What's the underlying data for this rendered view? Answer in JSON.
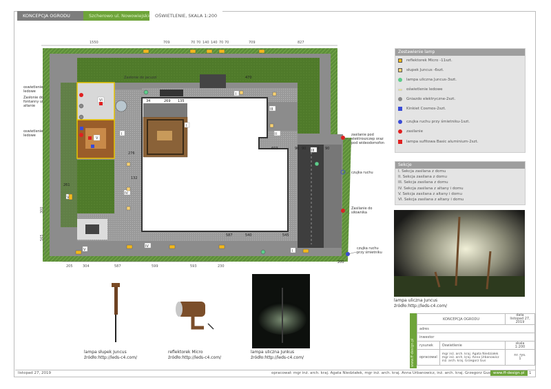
{
  "header": {
    "company": "KONCEPCJA OGRODU",
    "location": "Szcherowo ul. Nowowiejskiego",
    "drawing": "OŚWIETLENIE, SKALA 1:200"
  },
  "plan": {
    "dims_top": [
      "1550",
      "709",
      "70",
      "70",
      "140",
      "140",
      "70",
      "70",
      "709",
      "827"
    ],
    "dims_bottom": [
      "205",
      "304",
      "587",
      "599",
      "593",
      "230"
    ],
    "dims_left": [
      "300",
      "565"
    ],
    "inner_dims": {
      "d470": "470",
      "d34": "34",
      "d269": "269",
      "d135": "135",
      "d132": "132",
      "d276": "276",
      "d261": "261",
      "d603": "603",
      "d90a": "90",
      "d90b": "90",
      "d230": "230",
      "d90c": "90",
      "d200": "200",
      "d587": "587",
      "d540": "540",
      "d545": "545"
    },
    "labels": {
      "zaslonie_pd": "Zasłonie do jacuzzi",
      "ogrodowe": "oswietlenie ledowe",
      "zasl_fontanny": "Zasłonie do fontanny ui altanie",
      "oswietlenie_ledowe2": "oswietlenie ledowe",
      "zasilanie_pod": "zasilanie pod elektroszczep oraz pod wideodomofon",
      "czujka": "czujka ruchu",
      "zasilanie_slonik": "Zasilanie do siłownika",
      "czujka2": "czujka ruchu przy śmietniku"
    },
    "section_tags": [
      "VI",
      "V",
      "I",
      "I",
      "I",
      "III",
      "II",
      "IV",
      "IV",
      "V",
      "V",
      "III",
      "I"
    ]
  },
  "legend": {
    "title": "Zestawienie lamp",
    "items": [
      {
        "label": "reflektorek Micro -11szt.",
        "color": "#f2b81c",
        "kind": "rect-yellow-bar"
      },
      {
        "label": "słupek Juncus -6szt.",
        "color": "#f7d173",
        "kind": "square-light"
      },
      {
        "label": "lampa uliczna Juncus-3szt.",
        "color": "#5ecc8b",
        "kind": "circle-green"
      },
      {
        "label": "oświetlenie ledowe",
        "color": "#fff36b",
        "kind": "line-yellow"
      },
      {
        "label": "Gniazdo elektryczne-2szt.",
        "color": "#8a8a8a",
        "kind": "circle-gray"
      },
      {
        "label": "Kinkiet Cosmos-2szt.",
        "color": "#3a4cd6",
        "kind": "square-blue"
      },
      {
        "label": "czujka ruchu przy śmietniku-1szt.",
        "color": "#3a4cd6",
        "kind": "circle-blue"
      },
      {
        "label": "zasilanie",
        "color": "#e02020",
        "kind": "circle-red"
      },
      {
        "label": "lampa sufitowa Basic aluminium-2szt.",
        "color": "#e02020",
        "kind": "square-red"
      }
    ]
  },
  "sections": {
    "title": "Sekcje",
    "items": [
      "I. Sekcja zasilana z domu",
      "II. Sekcja zasilana z domu",
      "III. Sekcja zasilana z domu",
      "IV. Sekcja zasilana z altany i domu",
      "V. Sekcja zasilana z altany i domu",
      "VI. Sekcja zasilana z altany i domu"
    ]
  },
  "photos": {
    "p1": {
      "line1": "lampa słupek Juncus",
      "line2": "źródło:http://leds-c4.com/"
    },
    "p2": {
      "line1": "reflektorek Micro",
      "line2": "źródło:http://leds-c4.com/"
    },
    "p3": {
      "line1": "lampa uliczna Junkus",
      "line2": "źródło:http://leds-c4.com/"
    },
    "p4": {
      "line1": "lampa uliczna Juncus",
      "line2": "źródło:http://leds-c4.com/"
    }
  },
  "title_block": {
    "vertical": "www.ff-design.pl",
    "project_label": "KONCEPCJA OGRODU",
    "date_label": "data",
    "date_value": "listopad 27, 2019",
    "adres": "adres",
    "inwestor": "inwestor",
    "rysunek_label": "rysunek",
    "rysunek_value": "Oswietlenie",
    "skala_label": "skala",
    "skala_value": "1:200",
    "opracowal_label": "opracowal",
    "opracowal_value": "mgr inż. arch. kraj. Agata Niedziałek mgr inż. arch. kraj. Anna Urbanowicz inż. arch. kraj. Grzegorz Gus",
    "nr_label": "nr. rys.",
    "nr_value": "1"
  },
  "footer": {
    "date": "listopad 27, 2019",
    "authors": "opracował: mgr inż. arch. kraj. Agata Niedziałek, mgr inż. arch. kraj. Anna Urbanowicz, inż. arch. kraj. Grzegorz Gus",
    "web": "www.ff-design.pl",
    "page": "1"
  }
}
